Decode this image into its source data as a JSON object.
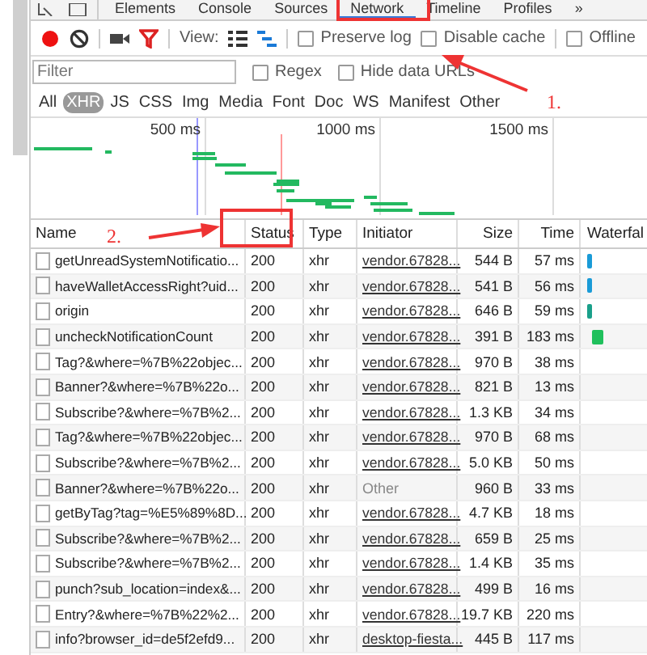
{
  "panel_tabs": [
    {
      "label": "Elements",
      "selected": false
    },
    {
      "label": "Console",
      "selected": false
    },
    {
      "label": "Sources",
      "selected": false
    },
    {
      "label": "Network",
      "selected": true
    },
    {
      "label": "Timeline",
      "selected": false
    },
    {
      "label": "Profiles",
      "selected": false
    },
    {
      "label": "»",
      "selected": false
    }
  ],
  "toolbar": {
    "recording": true,
    "view_label": "View:",
    "options": [
      {
        "label": "Preserve log",
        "checked": false
      },
      {
        "label": "Disable cache",
        "checked": false
      },
      {
        "label": "Offline",
        "checked": false
      }
    ]
  },
  "filter": {
    "placeholder": "Filter",
    "options": [
      {
        "label": "Regex",
        "checked": false
      },
      {
        "label": "Hide data URLs",
        "checked": false
      }
    ]
  },
  "type_filters": [
    {
      "label": "All",
      "selected": false
    },
    {
      "label": "XHR",
      "selected": true
    },
    {
      "label": "JS",
      "selected": false
    },
    {
      "label": "CSS",
      "selected": false
    },
    {
      "label": "Img",
      "selected": false
    },
    {
      "label": "Media",
      "selected": false
    },
    {
      "label": "Font",
      "selected": false
    },
    {
      "label": "Doc",
      "selected": false
    },
    {
      "label": "WS",
      "selected": false
    },
    {
      "label": "Manifest",
      "selected": false
    },
    {
      "label": "Other",
      "selected": false
    }
  ],
  "overview": {
    "ticks": [
      "500 ms",
      "1000 ms",
      "1500 ms"
    ]
  },
  "table": {
    "columns": [
      "Name",
      "Status",
      "Type",
      "Initiator",
      "Size",
      "Time",
      "Waterfal"
    ],
    "rows": [
      {
        "name": "getUnreadSystemNotificatio...",
        "status": "200",
        "type": "xhr",
        "initiator": "vendor.67828...",
        "initiator_link": true,
        "size": "544 B",
        "time": "57 ms",
        "color": "#1a9bd7"
      },
      {
        "name": "haveWalletAccessRight?uid...",
        "status": "200",
        "type": "xhr",
        "initiator": "vendor.67828...",
        "initiator_link": true,
        "size": "541 B",
        "time": "56 ms",
        "color": "#1a9bd7"
      },
      {
        "name": "origin",
        "status": "200",
        "type": "xhr",
        "initiator": "vendor.67828...",
        "initiator_link": true,
        "size": "646 B",
        "time": "59 ms",
        "color": "#1aa08a"
      },
      {
        "name": "uncheckNotificationCount",
        "status": "200",
        "type": "xhr",
        "initiator": "vendor.67828...",
        "initiator_link": true,
        "size": "391 B",
        "time": "183 ms",
        "color": "#20c05c"
      },
      {
        "name": "Tag?&where=%7B%22objec...",
        "status": "200",
        "type": "xhr",
        "initiator": "vendor.67828...",
        "initiator_link": true,
        "size": "970 B",
        "time": "38 ms"
      },
      {
        "name": "Banner?&where=%7B%22o...",
        "status": "200",
        "type": "xhr",
        "initiator": "vendor.67828...",
        "initiator_link": true,
        "size": "821 B",
        "time": "13 ms"
      },
      {
        "name": "Subscribe?&where=%7B%2...",
        "status": "200",
        "type": "xhr",
        "initiator": "vendor.67828...",
        "initiator_link": true,
        "size": "1.3 KB",
        "time": "34 ms"
      },
      {
        "name": "Tag?&where=%7B%22objec...",
        "status": "200",
        "type": "xhr",
        "initiator": "vendor.67828...",
        "initiator_link": true,
        "size": "970 B",
        "time": "68 ms"
      },
      {
        "name": "Subscribe?&where=%7B%2...",
        "status": "200",
        "type": "xhr",
        "initiator": "vendor.67828...",
        "initiator_link": true,
        "size": "5.0 KB",
        "time": "50 ms"
      },
      {
        "name": "Banner?&where=%7B%22o...",
        "status": "200",
        "type": "xhr",
        "initiator": "Other",
        "initiator_link": false,
        "size": "960 B",
        "time": "33 ms"
      },
      {
        "name": "getByTag?tag=%E5%89%8D...",
        "status": "200",
        "type": "xhr",
        "initiator": "vendor.67828...",
        "initiator_link": true,
        "size": "4.7 KB",
        "time": "18 ms"
      },
      {
        "name": "Subscribe?&where=%7B%2...",
        "status": "200",
        "type": "xhr",
        "initiator": "vendor.67828...",
        "initiator_link": true,
        "size": "659 B",
        "time": "25 ms"
      },
      {
        "name": "Subscribe?&where=%7B%2...",
        "status": "200",
        "type": "xhr",
        "initiator": "vendor.67828...",
        "initiator_link": true,
        "size": "1.4 KB",
        "time": "35 ms"
      },
      {
        "name": "punch?sub_location=index&...",
        "status": "200",
        "type": "xhr",
        "initiator": "vendor.67828...",
        "initiator_link": true,
        "size": "499 B",
        "time": "16 ms"
      },
      {
        "name": "Entry?&where=%7B%22%2...",
        "status": "200",
        "type": "xhr",
        "initiator": "vendor.67828...",
        "initiator_link": true,
        "size": "19.7 KB",
        "time": "220 ms"
      },
      {
        "name": "info?browser_id=de5f2efd9...",
        "status": "200",
        "type": "xhr",
        "initiator": "desktop-fiesta...",
        "initiator_link": true,
        "size": "445 B",
        "time": "117 ms"
      }
    ]
  },
  "annotations": [
    {
      "label": "1."
    },
    {
      "label": "2."
    }
  ]
}
